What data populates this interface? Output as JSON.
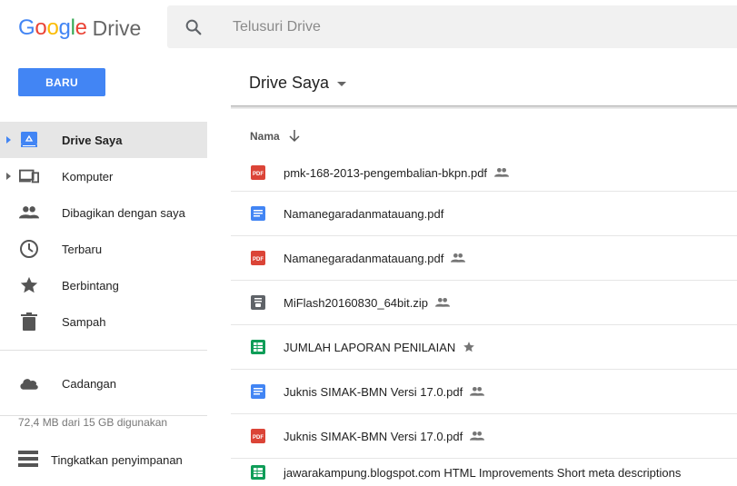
{
  "logo": {
    "google": "Google",
    "product": "Drive"
  },
  "search": {
    "placeholder": "Telusuri Drive"
  },
  "toolbar": {
    "new_label": "BARU",
    "title": "Drive Saya"
  },
  "sidebar": {
    "items": [
      {
        "label": "Drive Saya",
        "icon": "drive-icon",
        "active": true
      },
      {
        "label": "Komputer",
        "icon": "computer-icon"
      },
      {
        "label": "Dibagikan dengan saya",
        "icon": "people-icon"
      },
      {
        "label": "Terbaru",
        "icon": "clock-icon"
      },
      {
        "label": "Berbintang",
        "icon": "star-icon"
      },
      {
        "label": "Sampah",
        "icon": "trash-icon"
      }
    ],
    "backup": {
      "label": "Cadangan",
      "icon": "cloud-icon"
    },
    "storage": "72,4 MB dari 15 GB digunakan",
    "upgrade": {
      "label": "Tingkatkan penyimpanan",
      "icon": "storage-icon"
    }
  },
  "list": {
    "column_name": "Nama",
    "files": [
      {
        "name": "pmk-168-2013-pengembalian-bkpn.pdf",
        "type": "pdf",
        "badge": "shared"
      },
      {
        "name": "Namanegaradanmatauang.pdf",
        "type": "doc",
        "badge": ""
      },
      {
        "name": "Namanegaradanmatauang.pdf",
        "type": "pdf",
        "badge": "shared"
      },
      {
        "name": "MiFlash20160830_64bit.zip",
        "type": "zip",
        "badge": "shared"
      },
      {
        "name": "JUMLAH LAPORAN PENILAIAN",
        "type": "sheet",
        "badge": "starred"
      },
      {
        "name": "Juknis SIMAK-BMN Versi 17.0.pdf",
        "type": "doc",
        "badge": "shared"
      },
      {
        "name": "Juknis SIMAK-BMN Versi 17.0.pdf",
        "type": "pdf",
        "badge": "shared"
      },
      {
        "name": "jawarakampung.blogspot.com HTML Improvements Short meta descriptions",
        "type": "sheet",
        "badge": ""
      }
    ]
  },
  "colors": {
    "accent": "#4285f4",
    "pdf": "#db4437",
    "sheet": "#0f9d58",
    "zip": "#5f6368"
  }
}
